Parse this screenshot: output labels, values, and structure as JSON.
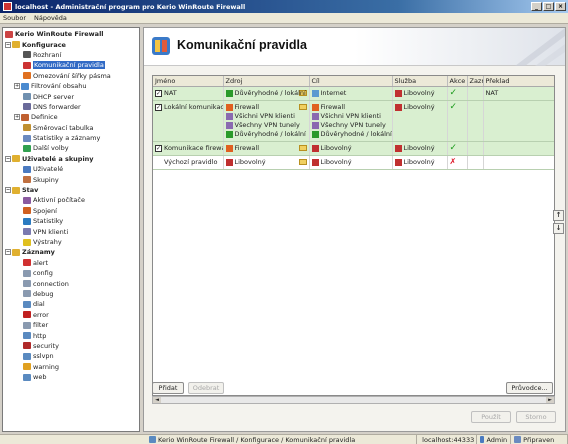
{
  "window": {
    "title": "localhost - Administrační program pro Kerio WinRoute Firewall",
    "controls": [
      "_",
      "□",
      "×"
    ]
  },
  "menu": [
    "Soubor",
    "Nápověda"
  ],
  "tree": [
    {
      "label": "Kerio WinRoute Firewall",
      "level": 0,
      "bold": true,
      "exp": "",
      "color": "#c44"
    },
    {
      "label": "Konfigurace",
      "level": 0,
      "bold": true,
      "exp": "−",
      "color": "#e0b030"
    },
    {
      "label": "Rozhraní",
      "level": 2,
      "color": "#555"
    },
    {
      "label": "Komunikační pravidla",
      "level": 2,
      "selected": true,
      "color": "#c33"
    },
    {
      "label": "Omezování šířky pásma",
      "level": 2,
      "color": "#e07020"
    },
    {
      "label": "Filtrování obsahu",
      "level": 1,
      "exp": "+",
      "color": "#4a8ad0"
    },
    {
      "label": "DHCP server",
      "level": 2,
      "color": "#7090b0"
    },
    {
      "label": "DNS forwarder",
      "level": 2,
      "color": "#6a6a9a"
    },
    {
      "label": "Definice",
      "level": 1,
      "exp": "+",
      "color": "#c06030"
    },
    {
      "label": "Směrovací tabulka",
      "level": 2,
      "color": "#c09030"
    },
    {
      "label": "Statistiky a záznamy",
      "level": 2,
      "color": "#6a8ac0"
    },
    {
      "label": "Další volby",
      "level": 2,
      "color": "#30a050"
    },
    {
      "label": "Uživatelé a skupiny",
      "level": 0,
      "bold": true,
      "exp": "−",
      "color": "#e0b030"
    },
    {
      "label": "Uživatelé",
      "level": 2,
      "color": "#4a7ac0"
    },
    {
      "label": "Skupiny",
      "level": 2,
      "color": "#c07040"
    },
    {
      "label": "Stav",
      "level": 0,
      "bold": true,
      "exp": "−",
      "color": "#e0b030"
    },
    {
      "label": "Aktivní počítače",
      "level": 2,
      "color": "#8a5aa0"
    },
    {
      "label": "Spojení",
      "level": 2,
      "color": "#d06020"
    },
    {
      "label": "Statistiky",
      "level": 2,
      "color": "#2a7ac0"
    },
    {
      "label": "VPN klienti",
      "level": 2,
      "color": "#7a7ab0"
    },
    {
      "label": "Výstrahy",
      "level": 2,
      "color": "#e0c020"
    },
    {
      "label": "Záznamy",
      "level": 0,
      "bold": true,
      "exp": "−",
      "color": "#e0b030"
    },
    {
      "label": "alert",
      "level": 2,
      "color": "#d03030"
    },
    {
      "label": "config",
      "level": 2,
      "color": "#8a9ab0"
    },
    {
      "label": "connection",
      "level": 2,
      "color": "#8a9ab0"
    },
    {
      "label": "debug",
      "level": 2,
      "color": "#8a9ab0"
    },
    {
      "label": "dial",
      "level": 2,
      "color": "#5a8ac0"
    },
    {
      "label": "error",
      "level": 2,
      "color": "#c02020"
    },
    {
      "label": "filter",
      "level": 2,
      "color": "#8a9ab0"
    },
    {
      "label": "http",
      "level": 2,
      "color": "#5a8ac0"
    },
    {
      "label": "security",
      "level": 2,
      "color": "#b02a2a"
    },
    {
      "label": "sslvpn",
      "level": 2,
      "color": "#5a8ac0"
    },
    {
      "label": "warning",
      "level": 2,
      "color": "#e0a020"
    },
    {
      "label": "web",
      "level": 2,
      "color": "#5a8ac0"
    }
  ],
  "page": {
    "title": "Komunikační pravidla"
  },
  "table": {
    "columns": [
      "Jméno",
      "Zdroj",
      "Cíl",
      "Služba",
      "Akce",
      "Zazn",
      "Překlad"
    ],
    "rows": [
      {
        "style": "green",
        "checked": true,
        "name": "NAT",
        "source": [
          {
            "icon": "#2a9a2a",
            "text": "Důvěryhodné / lokální"
          }
        ],
        "dest": [
          {
            "icon": "#5a9ad0",
            "text": "Internet"
          }
        ],
        "service": [
          {
            "icon": "#c03030",
            "text": "Libovolný"
          }
        ],
        "action": "ok",
        "log": "",
        "nat": "NAT"
      },
      {
        "style": "green",
        "checked": true,
        "name": "Lokální komunikace",
        "source": [
          {
            "icon": "#e06020",
            "text": "Firewall"
          },
          {
            "icon": "#8a6ab0",
            "text": "Všichni VPN klienti"
          },
          {
            "icon": "#8a6ab0",
            "text": "Všechny VPN tunely"
          },
          {
            "icon": "#2a9a2a",
            "text": "Důvěryhodné / lokální"
          }
        ],
        "dest": [
          {
            "icon": "#e06020",
            "text": "Firewall"
          },
          {
            "icon": "#8a6ab0",
            "text": "Všichni VPN klienti"
          },
          {
            "icon": "#8a6ab0",
            "text": "Všechny VPN tunely"
          },
          {
            "icon": "#2a9a2a",
            "text": "Důvěryhodné / lokální"
          }
        ],
        "service": [
          {
            "icon": "#c03030",
            "text": "Libovolný"
          }
        ],
        "action": "ok",
        "log": "",
        "nat": ""
      },
      {
        "style": "green",
        "checked": true,
        "name": "Komunikace firewallu",
        "source": [
          {
            "icon": "#e06020",
            "text": "Firewall"
          }
        ],
        "dest": [
          {
            "icon": "#c03030",
            "text": "Libovolný"
          }
        ],
        "service": [
          {
            "icon": "#c03030",
            "text": "Libovolný"
          }
        ],
        "action": "ok",
        "log": "",
        "nat": ""
      },
      {
        "style": "white",
        "checked": false,
        "name": "Výchozí pravidlo",
        "source": [
          {
            "icon": "#c03030",
            "text": "Libovolný"
          }
        ],
        "dest": [
          {
            "icon": "#c03030",
            "text": "Libovolný"
          }
        ],
        "service": [
          {
            "icon": "#c03030",
            "text": "Libovolný"
          }
        ],
        "action": "deny",
        "log": "",
        "nat": ""
      }
    ]
  },
  "buttons": {
    "add": "Přidat",
    "remove": "Odebrat",
    "wizard": "Průvodce...",
    "apply": "Použít",
    "reset": "Storno",
    "up": "↑",
    "down": "↓"
  },
  "status": [
    {
      "icon": "#5a8ac0",
      "text": "Kerio WinRoute Firewall / Konfigurace / Komunikační pravidla"
    },
    {
      "icon": "#5a8ac0",
      "text": "localhost:44333"
    },
    {
      "icon": "#4a7ac0",
      "text": "Admin"
    },
    {
      "icon": "#6a8ac0",
      "text": "Připraven"
    }
  ]
}
